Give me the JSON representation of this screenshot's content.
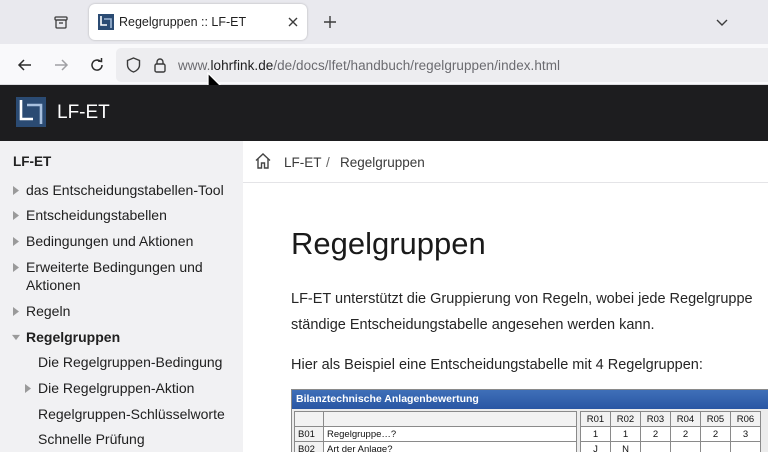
{
  "browser": {
    "tab": {
      "title": "Regelgruppen :: LF-ET"
    },
    "url": {
      "prefix": "www.",
      "domain": "lohrfink.de",
      "path": "/de/docs/lfet/handbuch/regelgruppen/index.html"
    },
    "icons": [
      "tab-list-icon",
      "favicon",
      "close-icon",
      "plus-icon",
      "chevron-down-icon",
      "back-arrow-icon",
      "forward-arrow-icon",
      "reload-icon",
      "shield-icon",
      "lock-icon",
      "mouse-cursor-icon"
    ]
  },
  "site": {
    "name": "LF-ET"
  },
  "sidebar": {
    "root": "LF-ET",
    "items": [
      {
        "label": "das Entscheidungstabellen-Tool",
        "level": 1,
        "state": "collapsed"
      },
      {
        "label": "Entscheidungstabellen",
        "level": 1,
        "state": "collapsed"
      },
      {
        "label": "Bedingungen und Aktionen",
        "level": 1,
        "state": "collapsed"
      },
      {
        "label": "Erweiterte Bedingungen und",
        "label2": "Aktionen",
        "level": 1,
        "state": "collapsed"
      },
      {
        "label": "Regeln",
        "level": 1,
        "state": "collapsed"
      },
      {
        "label": "Regelgruppen",
        "level": 1,
        "state": "expanded",
        "active": true
      },
      {
        "label": "Die Regelgruppen-Bedingung",
        "level": 2,
        "state": "leaf"
      },
      {
        "label": "Die Regelgruppen-Aktion",
        "level": 2,
        "state": "collapsed"
      },
      {
        "label": "Regelgruppen-Schlüsselworte",
        "level": 2,
        "state": "leaf"
      },
      {
        "label": "Schnelle Prüfung",
        "level": 2,
        "state": "leaf"
      }
    ]
  },
  "breadcrumb": {
    "items": [
      "LF-ET",
      "Regelgruppen"
    ],
    "separator": "/"
  },
  "main": {
    "title": "Regelgruppen",
    "paragraph1_line1": "LF-ET unterstützt die Gruppierung von Regeln, wobei jede Regelgruppe",
    "paragraph1_line2": "ständige Entscheidungstabelle angesehen werden kann.",
    "paragraph2": "Hier als Beispiel eine Entscheidungstabelle mit 4 Regelgruppen:"
  },
  "decision_table": {
    "title": "Bilanztechnische Anlagenbewertung",
    "rules": [
      "R01",
      "R02",
      "R03",
      "R04",
      "R05",
      "R06"
    ],
    "rows": [
      {
        "id": "B01",
        "text": "Regelgruppe…?",
        "values": [
          "1",
          "1",
          "2",
          "2",
          "2",
          "3"
        ]
      },
      {
        "id": "B02",
        "text": "Art der Anlage?",
        "values": [
          "J",
          "N",
          "",
          "",
          "",
          ""
        ]
      }
    ]
  },
  "colors": {
    "header_bg": "#1d1d1f",
    "sidebar_bg": "#f1f1f3",
    "table_title_bg": "#2f5fae"
  }
}
